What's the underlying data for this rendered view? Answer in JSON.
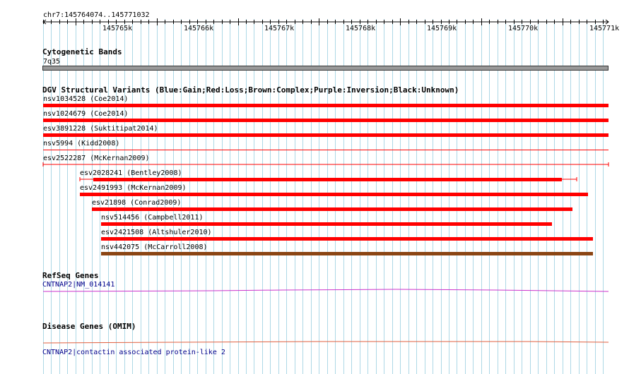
{
  "ruler": {
    "label": "chr7:145764074..145771032",
    "ticks": [
      "145765k",
      "145766k",
      "145767k",
      "145768k",
      "145769k",
      "145770k",
      "145771k"
    ]
  },
  "cytoband": {
    "title": "Cytogenetic Bands",
    "band": "7q35"
  },
  "dgv": {
    "title": "DGV Structural Variants (Blue:Gain;Red:Loss;Brown:Complex;Purple:Inversion;Black:Unknown)",
    "variants": [
      {
        "label": "nsv1034528 (Coe2014)",
        "type": "loss"
      },
      {
        "label": "nsv1024679 (Coe2014)",
        "type": "loss"
      },
      {
        "label": "esv3891228 (Suktitipat2014)",
        "type": "loss"
      },
      {
        "label": "nsv5994 (Kidd2008)",
        "type": "loss"
      },
      {
        "label": "esv2522287 (McKernan2009)",
        "type": "loss"
      },
      {
        "label": "esv2028241 (Bentley2008)",
        "type": "loss"
      },
      {
        "label": "esv2491993 (McKernan2009)",
        "type": "loss"
      },
      {
        "label": "esv21898 (Conrad2009)",
        "type": "loss"
      },
      {
        "label": "nsv514456 (Campbell2011)",
        "type": "loss"
      },
      {
        "label": "esv2421508 (Altshuler2010)",
        "type": "loss"
      },
      {
        "label": "nsv442075 (McCarroll2008)",
        "type": "complex"
      }
    ]
  },
  "refseq": {
    "title": "RefSeq Genes",
    "gene": "CNTNAP2|NM_014141"
  },
  "omim": {
    "title": "Disease Genes (OMIM)",
    "gene": "CNTNAP2|contactin associated protein-like 2"
  },
  "colors": {
    "loss": "#ff0000",
    "complex": "#8b4513",
    "grid": "#add8e6",
    "refseq": "#cc33cc",
    "omim": "#e06040"
  }
}
